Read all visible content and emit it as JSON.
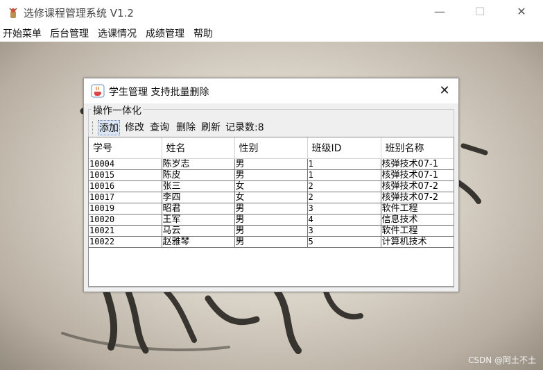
{
  "window": {
    "title": "选修课程管理系统 V1.2",
    "min_glyph": "—",
    "max_glyph": "☐",
    "close_glyph": "✕"
  },
  "menu": [
    "开始菜单",
    "后台管理",
    "选课情况",
    "成绩管理",
    "帮助"
  ],
  "dialog": {
    "title": "学生管理  支持批量删除",
    "close_glyph": "✕",
    "group_label": "操作一体化",
    "toolbar": {
      "add": "添加",
      "edit": "修改",
      "query": "查询",
      "delete": "删除",
      "refresh": "刷新",
      "record_count": "记录数:8"
    },
    "table": {
      "columns": [
        "学号",
        "姓名",
        "性别",
        "班级ID",
        "班别名称"
      ],
      "rows": [
        [
          "10004",
          "陈岁志",
          "男",
          "1",
          "核弹技术07-1"
        ],
        [
          "10015",
          "陈皮",
          "男",
          "1",
          "核弹技术07-1"
        ],
        [
          "10016",
          "张三",
          "女",
          "2",
          "核弹技术07-2"
        ],
        [
          "10017",
          "李四",
          "女",
          "2",
          "核弹技术07-2"
        ],
        [
          "10019",
          "昭君",
          "男",
          "3",
          "软件工程"
        ],
        [
          "10020",
          "王军",
          "男",
          "4",
          "信息技术"
        ],
        [
          "10021",
          "马云",
          "男",
          "3",
          "软件工程"
        ],
        [
          "10022",
          "赵雅琴",
          "男",
          "5",
          "计算机技术"
        ]
      ]
    }
  },
  "watermark": "CSDN @阿土不土",
  "colors": {
    "selection_highlight": "#dbe6f4",
    "table_grid": "#777777",
    "dialog_bg": "#efefef"
  }
}
